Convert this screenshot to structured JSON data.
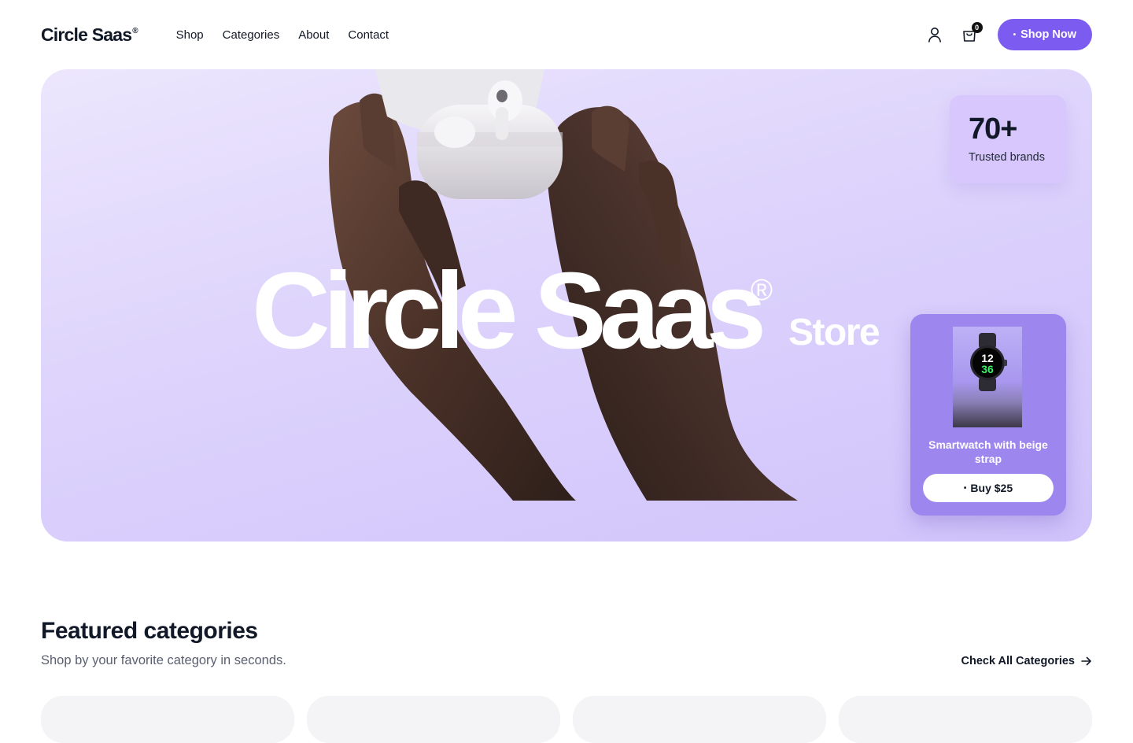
{
  "brand": {
    "name": "Circle Saas",
    "reg": "®"
  },
  "nav": {
    "items": [
      "Shop",
      "Categories",
      "About",
      "Contact"
    ]
  },
  "header": {
    "cart_count": "0",
    "cta_label": "Shop Now",
    "cta_dot": "•"
  },
  "hero": {
    "title": "Circle Saas",
    "title_reg": "®",
    "subtitle": "Store",
    "stat": {
      "value": "70+",
      "label": "Trusted brands"
    },
    "product": {
      "name": "Smartwatch with beige strap",
      "buy_label": "Buy $25",
      "watch_hour": "12",
      "watch_minute": "36"
    }
  },
  "featured": {
    "title": "Featured categories",
    "subtitle": "Shop by your favorite category in seconds.",
    "link_label": "Check All Categories"
  },
  "colors": {
    "accent": "#7c5cf0",
    "hero_bg": "#ddd3fc",
    "card_bg": "#9d86ee"
  }
}
